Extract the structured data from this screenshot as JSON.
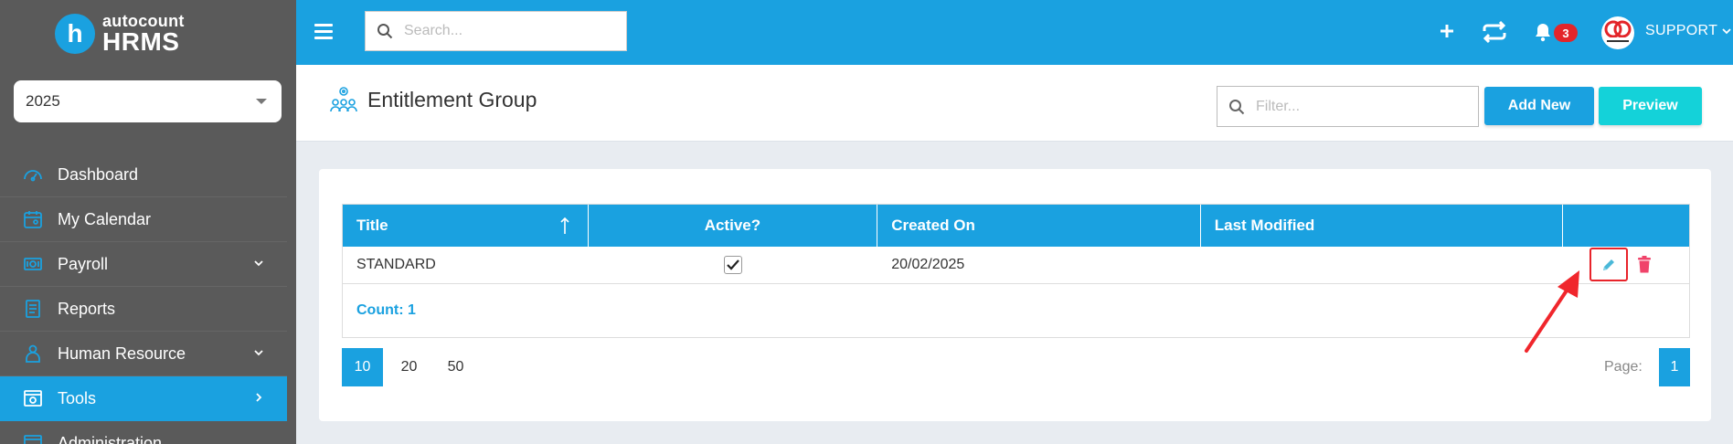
{
  "app": {
    "logo_mark": "h",
    "logo_line1": "autocount",
    "logo_line2": "HRMS"
  },
  "sidebar": {
    "year": "2025",
    "items": [
      {
        "label": "Dashboard",
        "icon": "dashboard-icon"
      },
      {
        "label": "My Calendar",
        "icon": "calendar-icon"
      },
      {
        "label": "Payroll",
        "icon": "payroll-icon"
      },
      {
        "label": "Reports",
        "icon": "reports-icon"
      },
      {
        "label": "Human Resource",
        "icon": "human-resource-icon"
      },
      {
        "label": "Tools",
        "icon": "tools-icon"
      },
      {
        "label": "Administration",
        "icon": "administration-icon"
      }
    ]
  },
  "topbar": {
    "search_placeholder": "Search...",
    "notification_count": "3",
    "user_name": "SUPPORT"
  },
  "page": {
    "title": "Entitlement Group",
    "filter_placeholder": "Filter...",
    "add_new_label": "Add New",
    "preview_label": "Preview"
  },
  "grid": {
    "columns": [
      "Title",
      "Active?",
      "Created On",
      "Last Modified"
    ],
    "rows": [
      {
        "title": "STANDARD",
        "active": true,
        "created_on": "20/02/2025",
        "last_modified": ""
      }
    ],
    "count_label": "Count: 1"
  },
  "pager": {
    "sizes": [
      "10",
      "20",
      "50"
    ],
    "active_size": "10",
    "page_label": "Page:",
    "current_page": "1"
  },
  "colors": {
    "accent": "#1aa1e0",
    "preview": "#14d2d9",
    "sidebar": "#5a5a5a",
    "highlight": "#e8232a",
    "delete": "#f0436a"
  }
}
